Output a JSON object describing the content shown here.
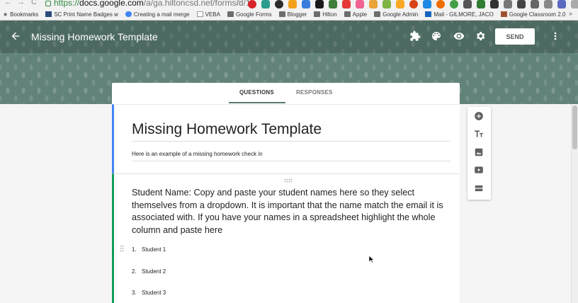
{
  "browser": {
    "url_scheme": "https://",
    "url_host": "docs.google.com",
    "url_path": "/forms/d/1",
    "url_subpath": "/a/ga.hiltoncsd.net",
    "bookmarks": [
      {
        "label": "Bookmarks",
        "icon": "star-icon"
      },
      {
        "label": "SC Print Name Badges w",
        "icon": "sc-icon"
      },
      {
        "label": "Creating a mail merge",
        "icon": "google-icon"
      },
      {
        "label": "VEBA",
        "icon": "page-icon"
      },
      {
        "label": "Google Forms",
        "icon": "folder-icon"
      },
      {
        "label": "Blogger",
        "icon": "folder-icon"
      },
      {
        "label": "Hilton",
        "icon": "folder-icon"
      },
      {
        "label": "Apple",
        "icon": "folder-icon"
      },
      {
        "label": "Google Admin",
        "icon": "folder-icon"
      },
      {
        "label": "Mail - GILMORE, JACO",
        "icon": "mail-icon"
      },
      {
        "label": "Google Classroom 2.0",
        "icon": "classroom-icon"
      }
    ],
    "more_bookmarks": "»"
  },
  "header": {
    "title": "Missing Homework Template",
    "send_label": "SEND",
    "accent_color": "#62837a"
  },
  "tabs": {
    "questions": "QUESTIONS",
    "responses": "RESPONSES"
  },
  "form": {
    "title": "Missing Homework Template",
    "description": "Here is an example of a missing homework check in"
  },
  "question": {
    "text": "Student Name: Copy and paste your student names here so they select themselves from a dropdown. It is important that the name match the email it is associated with. If you have your names in a spreadsheet highlight the whole column and paste here",
    "options": [
      {
        "num": "1.",
        "label": "Student 1"
      },
      {
        "num": "2.",
        "label": "Student 2"
      },
      {
        "num": "3.",
        "label": "Student 3"
      }
    ]
  }
}
